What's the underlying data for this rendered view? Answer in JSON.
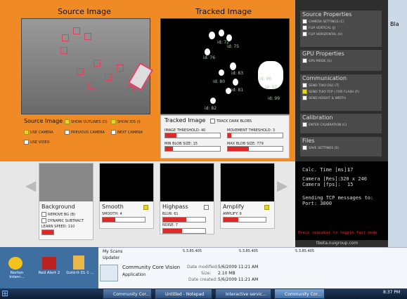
{
  "source_panel": {
    "title": "Source Image",
    "caption": "Source Image",
    "options": [
      {
        "label": "SHOW OUTLINES (D)",
        "checked": true
      },
      {
        "label": "SHOW IDS (I)",
        "checked": true
      },
      {
        "label": "USE CAMERA",
        "checked": true
      },
      {
        "label": "PREVIOUS CAMERA",
        "checked": false
      },
      {
        "label": "NEXT CAMERA",
        "checked": false
      },
      {
        "label": "USE VIDEO",
        "checked": false
      }
    ]
  },
  "tracked_panel": {
    "title": "Tracked Image",
    "caption": "Tracked Image",
    "track_dark_label": "TRACK DARK BLOBS",
    "image_threshold": "IMAGE THRESHOLD: 40",
    "movement_threshold": "MOVEMENT THRESHOLD: 3",
    "min_blob": "MIN BLOB SIZE: 15",
    "max_blob": "MAX BLOB SIZE: 779",
    "ids": [
      "id: 72",
      "id: 75",
      "id: 76",
      "id: 83",
      "id: 80",
      "id: 81",
      "id: 96",
      "id: 97",
      "id: 99",
      "id: 82"
    ]
  },
  "filters": {
    "background": {
      "title": "Background",
      "remove_bg": "REMOVE BG (B)",
      "dynamic": "DYNAMIC SUBTRACT",
      "learn": "LEARN SPEED: 110"
    },
    "smooth": {
      "title": "Smooth",
      "value": "SMOOTH: 4",
      "checked": true
    },
    "highpass": {
      "title": "Highpass",
      "blur": "BLUR: 61",
      "noise": "NOISE: 7",
      "checked": false
    },
    "amplify": {
      "title": "Amplify",
      "value": "AMPLIFY: 9",
      "checked": true
    }
  },
  "right_panel": {
    "groups": [
      {
        "title": "Source Properties",
        "items": [
          "CAMERA SETTINGS (C)",
          "FLIP VERTICAL (J)",
          "FLIP HORIZONTAL (H)"
        ]
      },
      {
        "title": "GPU Properties",
        "items": [
          "GPU MODE (G)"
        ]
      },
      {
        "title": "Communication",
        "items": [
          "SEND TUIO OSC (T)",
          "SEND TUIO TCP ( FOR FLASH (F)",
          "SEND HEIGHT & WIDTH"
        ]
      },
      {
        "title": "Calibration",
        "items": [
          "ENTER CALIBRATION (C)"
        ]
      },
      {
        "title": "Files",
        "items": [
          "SAVE SETTINGS (S)"
        ]
      }
    ],
    "calc_time_label": "Calc. Time [ms]:",
    "calc_time_value": "17",
    "camera_res_label": "Camera [Res]:",
    "camera_res_value": "320 x 240",
    "camera_fps_label": "Camera [fps]:",
    "camera_fps_value": "15",
    "tcp_line1": "Sending TCP messages to:",
    "tcp_line2": "Port: 3000",
    "hint": "Press spacebar to toggle fast mode",
    "footer": "tbeta.nuigroup.com"
  },
  "explorer": {
    "item1": "My Scans",
    "item2": "Updater",
    "versions": [
      "5.3.85.405",
      "5.3.85.405",
      "5.3.85.405"
    ],
    "file_name": "Community Core Vision",
    "file_type": "Application",
    "modified_label": "Date modified:",
    "modified": "5/6/2009 11:21 AM",
    "size_label": "Size:",
    "size": "2.10 MB",
    "created_label": "Date created:",
    "created": "5/6/2009 11:21 AM"
  },
  "desktop_icons": [
    {
      "label": "Norton Intern..."
    },
    {
      "label": "Red Alert 2"
    },
    {
      "label": "Gold-0-31-1 ..."
    }
  ],
  "taskbar": {
    "buttons": [
      "Community Cor...",
      "Untitled - Notepad",
      "Interactive servic...",
      "Community Cor..."
    ],
    "clock": "8:37 PM"
  },
  "bg_side_text": "Bla"
}
